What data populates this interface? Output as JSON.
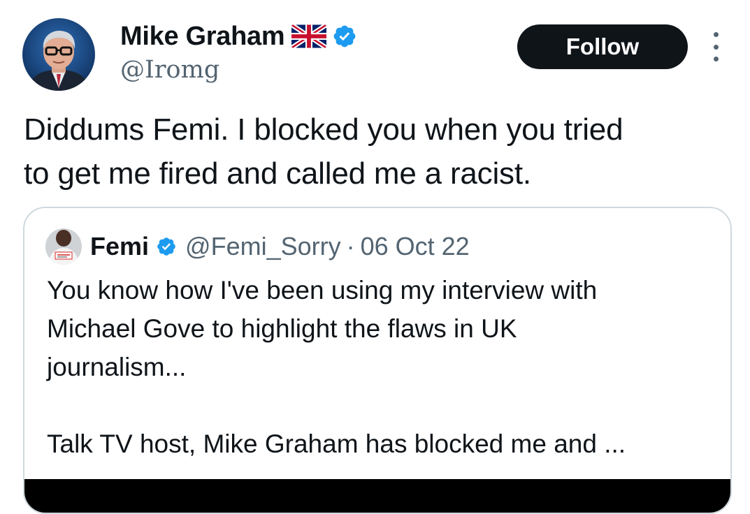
{
  "author": {
    "display_name": "Mike Graham",
    "flag_icon": "united-kingdom-flag-emoji",
    "verified_icon": "verified-badge-icon",
    "handle": "@Iromg"
  },
  "actions": {
    "follow_label": "Follow",
    "more_icon": "more-options-icon"
  },
  "tweet": {
    "text": "Diddums Femi. I blocked you when you tried\nto get me fired and called me a racist."
  },
  "quoted_tweet": {
    "display_name": "Femi",
    "handle": "@Femi_Sorry",
    "separator": "·",
    "date": "06 Oct 22",
    "text": "You know how I've been using my interview with\nMichael Gove to highlight the flaws in UK\njournalism...\n\nTalk TV host, Mike Graham has blocked me and ..."
  },
  "colors": {
    "text_primary": "#0f1419",
    "text_secondary": "#536471",
    "verified_blue": "#1d9bf0",
    "follow_bg": "#0f1419",
    "follow_text": "#ffffff",
    "card_border": "#cfd9de"
  }
}
